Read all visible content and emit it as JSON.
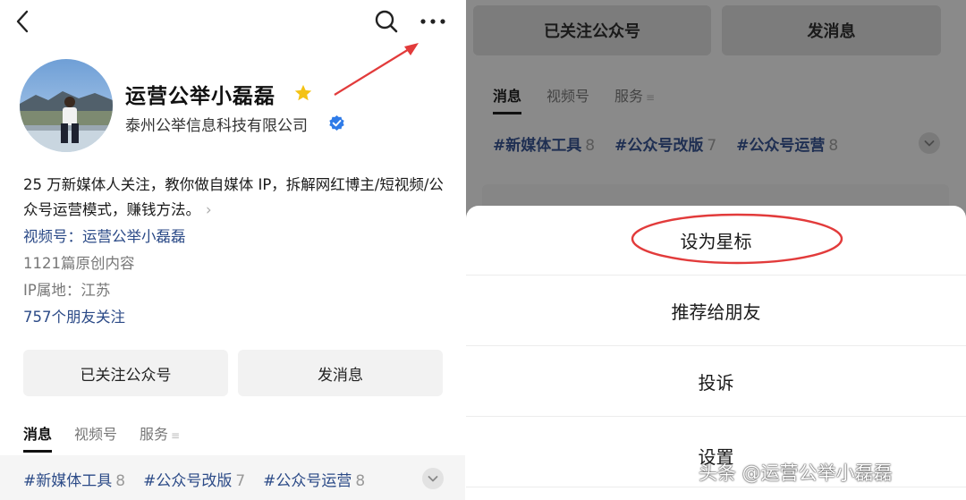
{
  "left": {
    "account_name": "运营公举小磊磊",
    "company": "泰州公举信息科技有限公司",
    "intro": "25 万新媒体人关注，教你做自媒体 IP，拆解网红博主/短视频/公众号运营模式，赚钱方法。",
    "intro_chevron": "›",
    "channel_link": "视频号：运营公举小磊磊",
    "original_count": "1121篇原创内容",
    "ip_location": "IP属地：江苏",
    "friends_follow": "757个朋友关注",
    "buttons": {
      "followed": "已关注公众号",
      "message": "发消息"
    },
    "tabs": [
      {
        "label": "消息"
      },
      {
        "label": "视频号"
      },
      {
        "label": "服务",
        "suffix": "≡"
      }
    ],
    "tags": [
      {
        "label": "#新媒体工具",
        "count": "8"
      },
      {
        "label": "#公众号改版",
        "count": "7"
      },
      {
        "label": "#公众号运营",
        "count": "8"
      }
    ]
  },
  "right": {
    "buttons": {
      "followed": "已关注公众号",
      "message": "发消息"
    },
    "tabs": [
      {
        "label": "消息"
      },
      {
        "label": "视频号"
      },
      {
        "label": "服务",
        "suffix": "≡"
      }
    ],
    "tags": [
      {
        "label": "#新媒体工具",
        "count": "8"
      },
      {
        "label": "#公众号改版",
        "count": "7"
      },
      {
        "label": "#公众号运营",
        "count": "8"
      }
    ],
    "sheet": {
      "star": "设为星标",
      "recommend": "推荐给朋友",
      "report": "投诉",
      "settings": "设置"
    }
  },
  "watermark": "头条 @运营公举小磊磊",
  "colors": {
    "link": "#2b4a87",
    "star": "#f4c214",
    "verified": "#2f7be8",
    "annotation": "#e23b3b",
    "overlay": "#8a8a8a"
  },
  "icons": [
    "back-icon",
    "search-icon",
    "more-icon",
    "star-icon",
    "verified-icon",
    "chevron-down-icon"
  ]
}
